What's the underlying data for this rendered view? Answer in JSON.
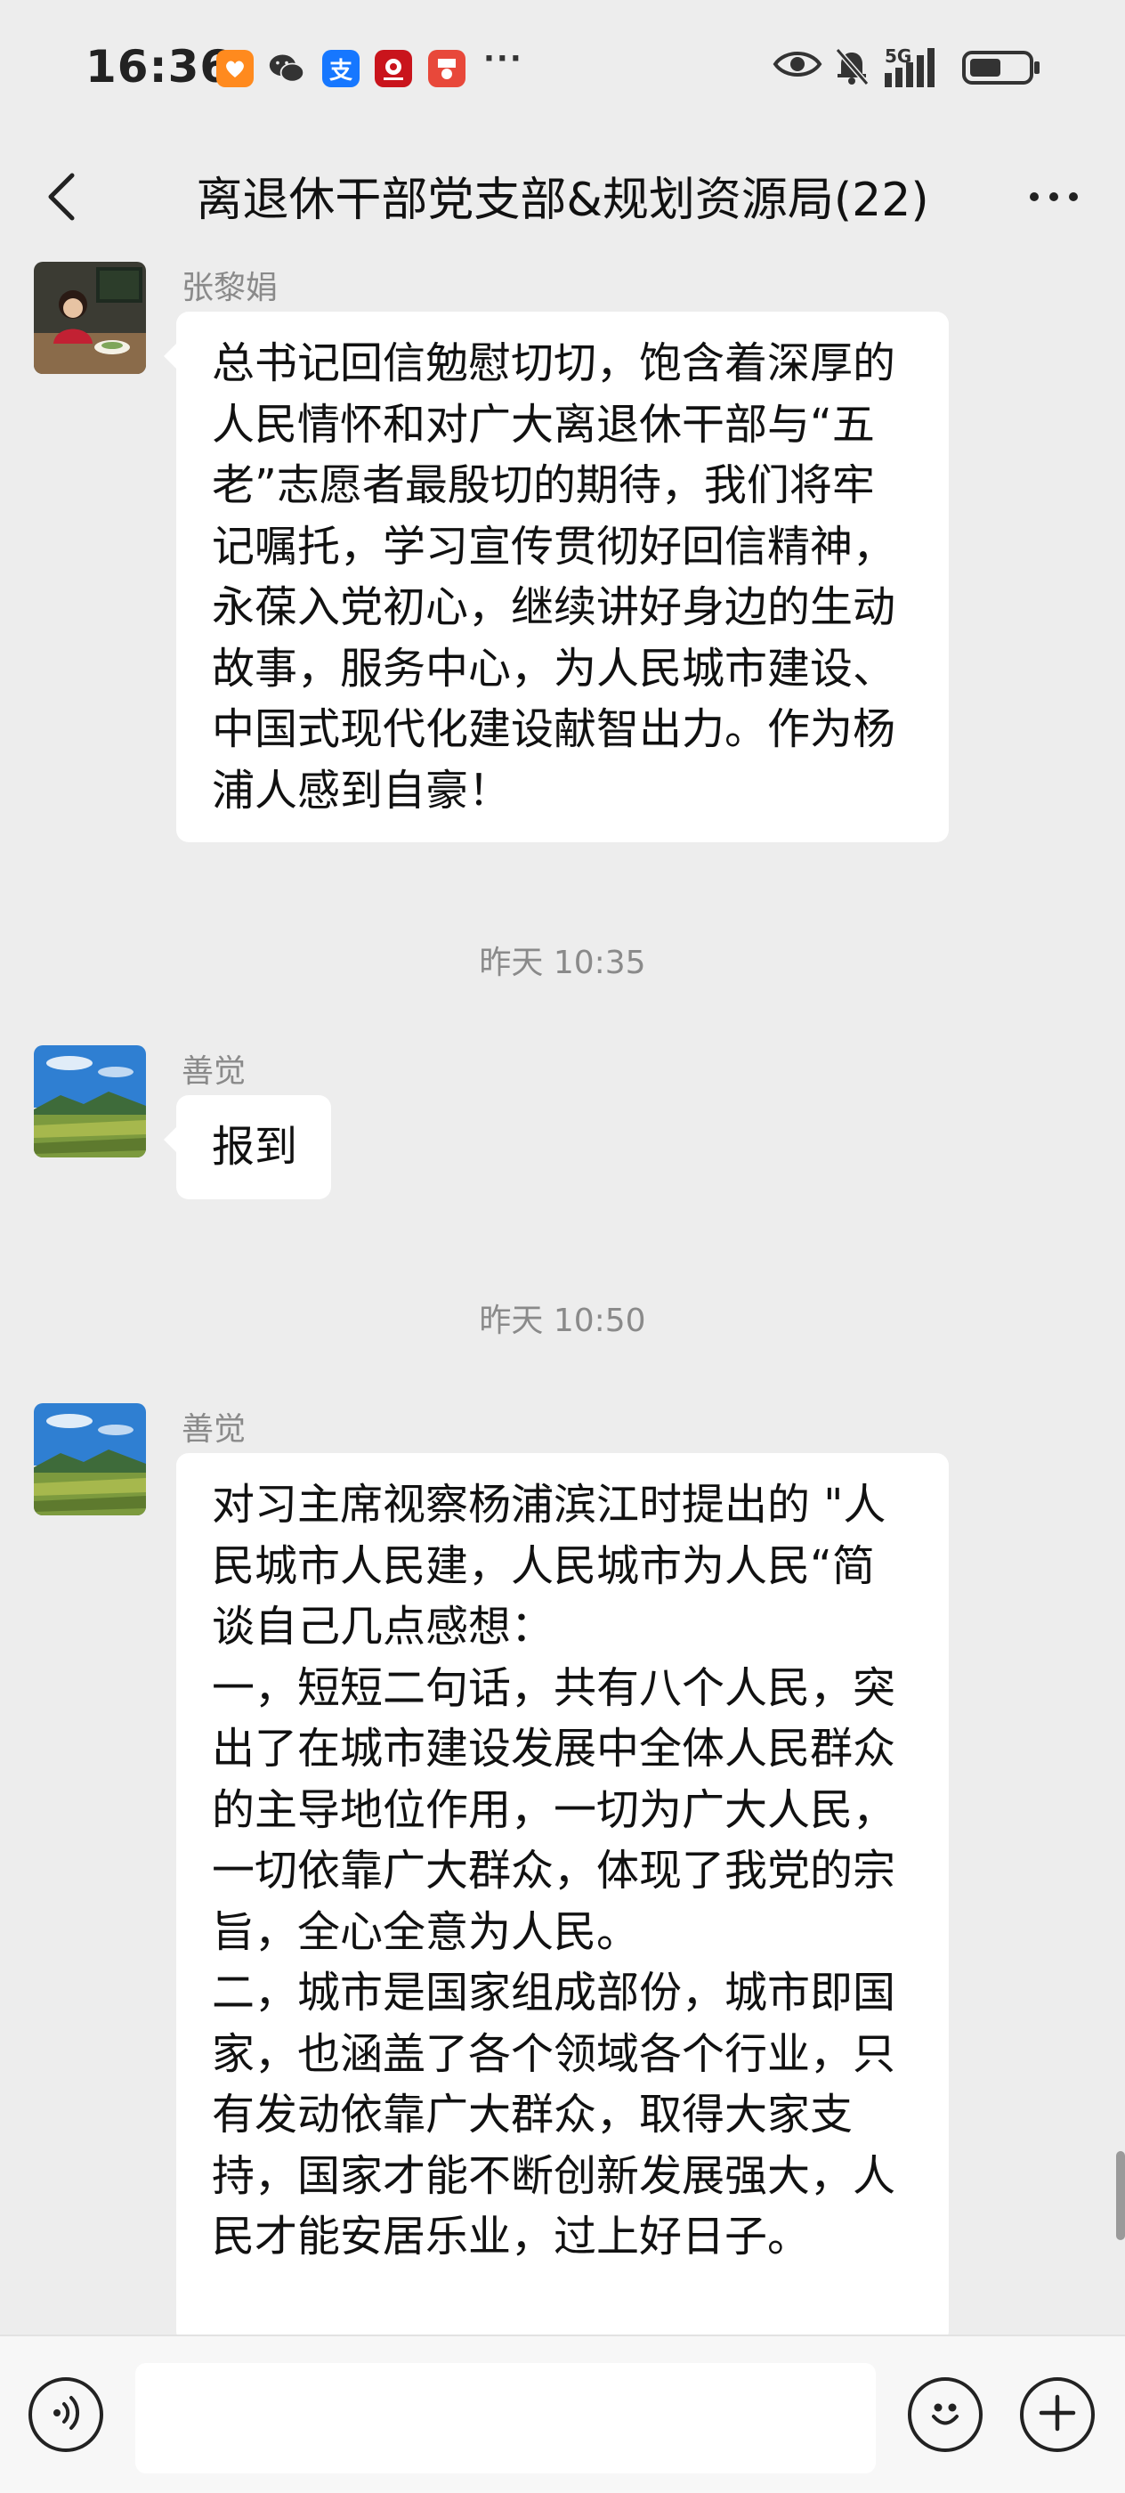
{
  "status_bar": {
    "time": "16:36",
    "more_indicator": "···",
    "network_label": "5G",
    "icons": [
      "taobao-icon",
      "wechat-icon",
      "alipay-icon",
      "vodafone-app-icon",
      "news-app-icon",
      "eye-icon",
      "mute-bell-icon",
      "signal-icon",
      "battery-icon"
    ]
  },
  "header": {
    "title": "离退休干部党支部&规划资源局(22)"
  },
  "messages": [
    {
      "type": "message",
      "sender": "张黎娟",
      "text": "总书记回信勉慰切切，饱含着深厚的人民情怀和对广大离退休干部与“五老”志愿者最殷切的期待，我们将牢记嘱托，学习宣传贯彻好回信精神，永葆入党初心，继续讲好身边的生动故事，服务中心，为人民城市建设、中国式现代化建设献智出力。作为杨浦人感到自豪！"
    },
    {
      "type": "timestamp",
      "text": "昨天 10:35"
    },
    {
      "type": "message",
      "sender": "善觉",
      "text": "报到"
    },
    {
      "type": "timestamp",
      "text": "昨天 10:50"
    },
    {
      "type": "message",
      "sender": "善觉",
      "text": "对习主席视察杨浦滨江时提出的 \"人民城市人民建，人民城市为人民“简谈自己几点感想：\n一，短短二句话，共有八个人民，突出了在城市建设发展中全体人民群众的主导地位作用，一切为广大人民，一切依靠广大群众，体现了我党的宗旨，全心全意为人民。\n二，城市是国家组成部份，城市即国家，也涵盖了各个领域各个行业，只有发动依靠广大群众，取得大家支持，国家才能不断创新发展强大，人民才能安居乐业，过上好日子。"
    }
  ],
  "input_bar": {
    "input_value": "",
    "voice_icon": "voice-icon",
    "emoji_icon": "emoji-icon",
    "plus_icon": "plus-icon"
  },
  "colors": {
    "background": "#ededed",
    "bubble": "#ffffff",
    "meta_text": "#8a8a8a"
  }
}
